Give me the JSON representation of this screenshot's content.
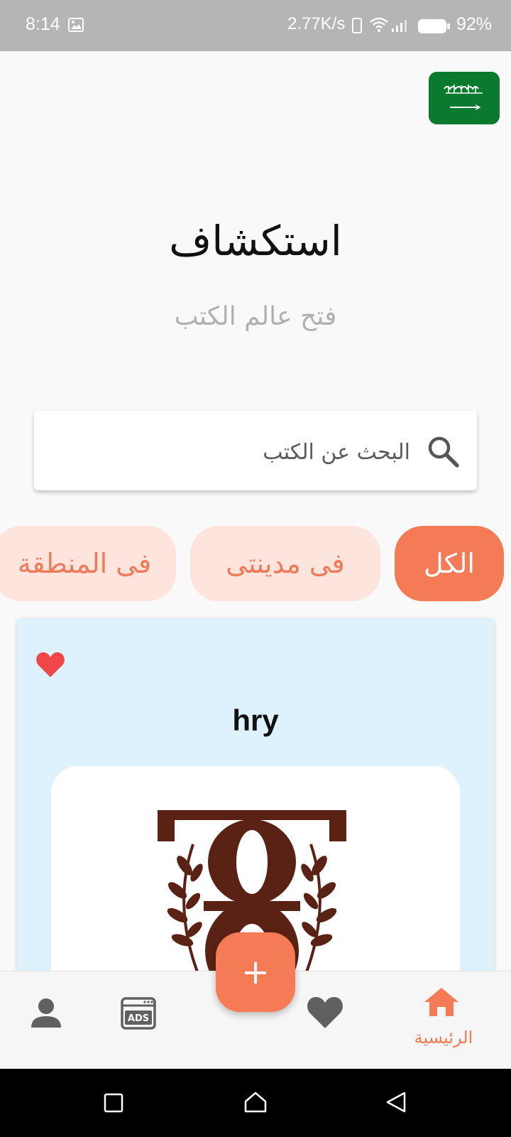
{
  "status_bar": {
    "time": "8:14",
    "network_speed": "2.77K/s",
    "battery": "92%"
  },
  "header": {
    "title": "استكشاف",
    "subtitle": "فتح عالم الكتب"
  },
  "search": {
    "placeholder": "البحث عن الكتب"
  },
  "filters": {
    "all": "الكل",
    "my_city": "فى مدينتى",
    "region": "فى المنطقة",
    "selected": "الكل"
  },
  "book_card": {
    "title": "hry",
    "favorited": true
  },
  "bottom_nav": {
    "home_label": "الرئيسية",
    "fab_symbol": "+",
    "items": [
      "profile-icon",
      "ads-icon",
      "add-button",
      "heart-icon",
      "home-icon"
    ]
  },
  "colors": {
    "accent": "#f47b55",
    "chip_inactive_bg": "#fde4dd",
    "card_bg": "#def2fd",
    "heart": "#f2474a",
    "flag_green": "#0a7a2e"
  }
}
